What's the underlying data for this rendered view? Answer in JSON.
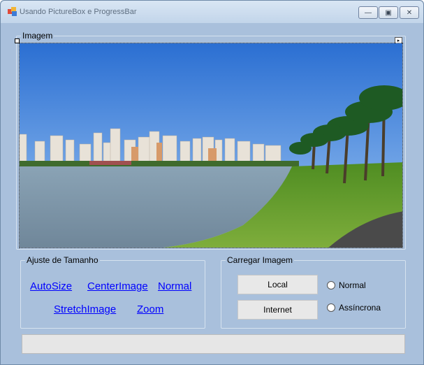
{
  "window": {
    "title": "Usando PictureBox e ProgressBar",
    "minimize_glyph": "—",
    "maximize_glyph": "▣",
    "close_glyph": "✕"
  },
  "image_group": {
    "label": "Imagem",
    "picture_description_icon": "landscape-photo",
    "smart_tag_glyph": "▸"
  },
  "size_group": {
    "label": "Ajuste de Tamanho",
    "links": [
      "AutoSize",
      "CenterImage",
      "Normal",
      "StretchImage",
      "Zoom"
    ]
  },
  "load_group": {
    "label": "Carregar Imagem",
    "local_button": "Local",
    "internet_button": "Internet",
    "radio_normal": "Normal",
    "radio_async": "Assíncrona"
  },
  "progress": {
    "value": 0
  }
}
